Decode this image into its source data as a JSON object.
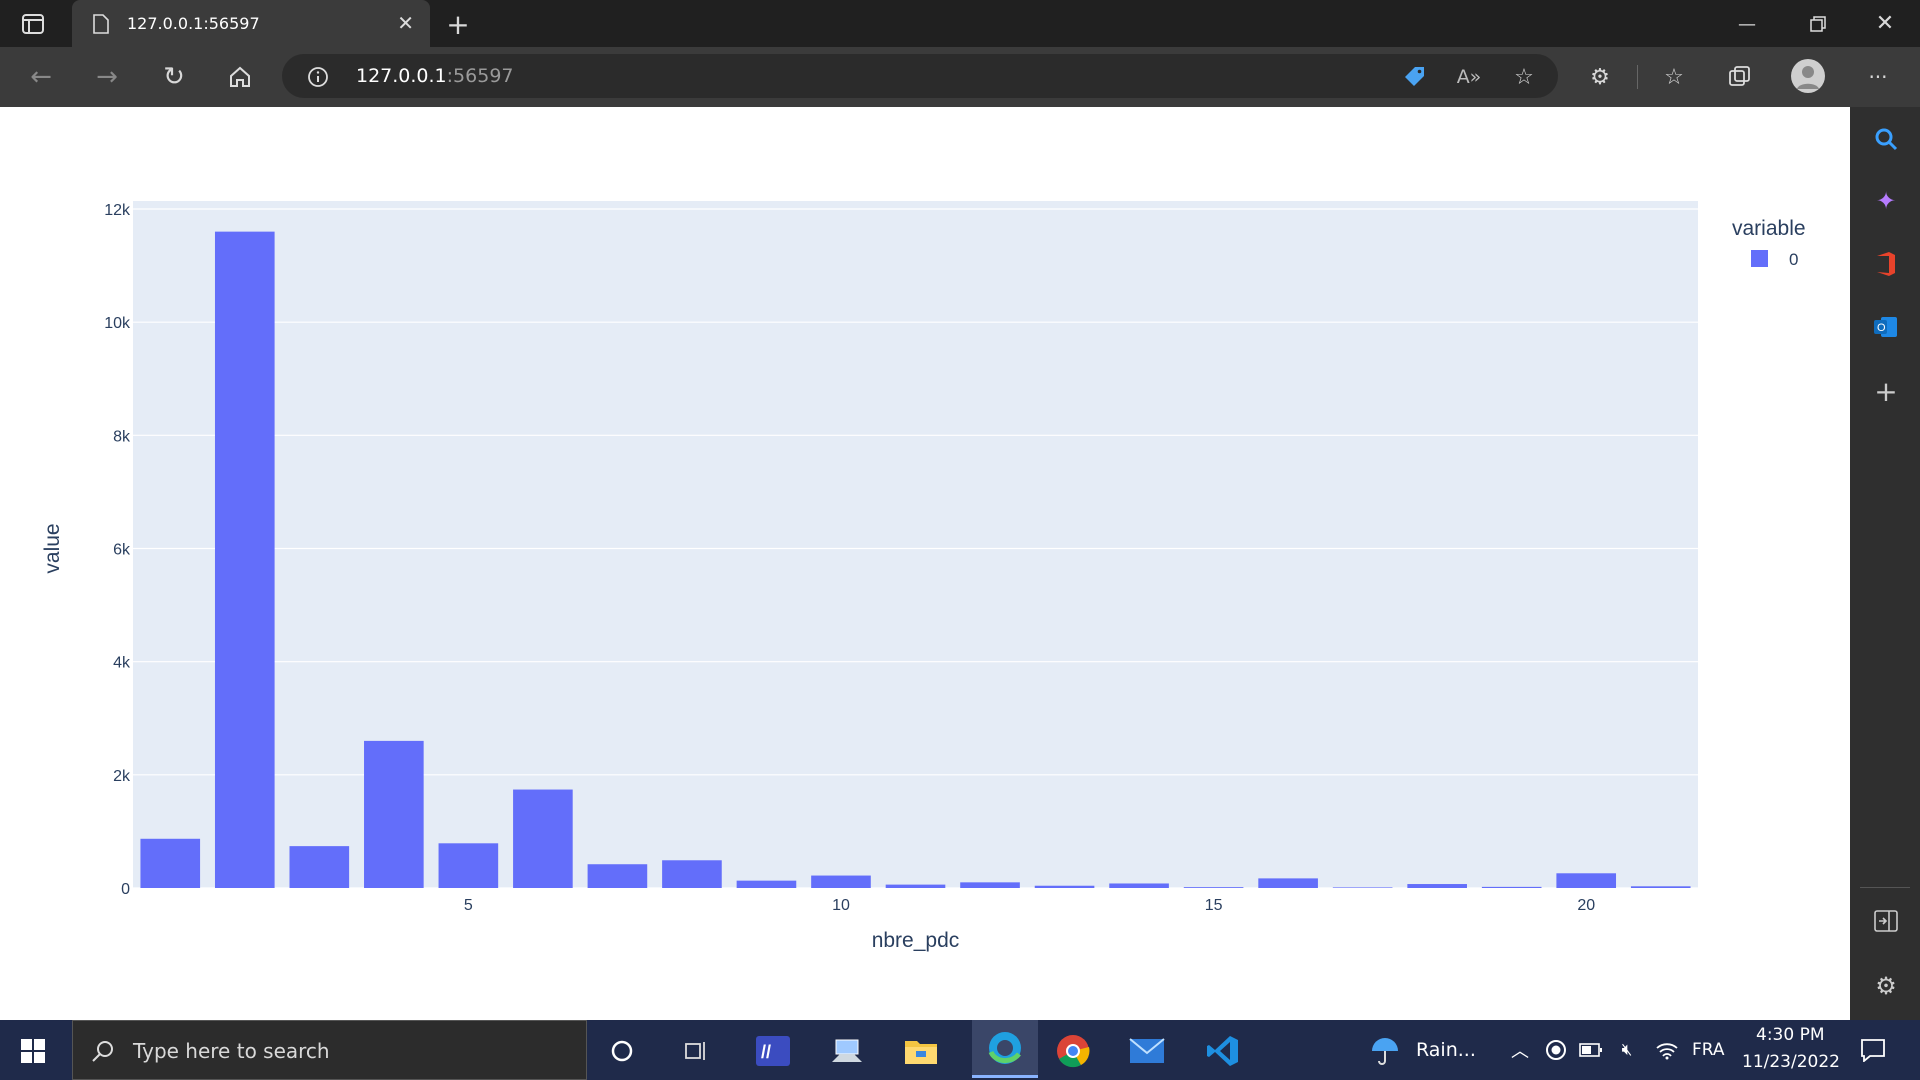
{
  "browser": {
    "tab_title": "127.0.0.1:56597",
    "url_host": "127.0.0.1",
    "url_port": ":56597"
  },
  "taskbar": {
    "search_placeholder": "Type here to search",
    "weather": "Rain...",
    "language": "FRA",
    "time": "4:30 PM",
    "date": "11/23/2022"
  },
  "chart_data": {
    "type": "bar",
    "xlabel": "nbre_pdc",
    "ylabel": "value",
    "legend_title": "variable",
    "legend_position": "top-right",
    "ylim": [
      0,
      12000
    ],
    "xlim": [
      0.5,
      21.5
    ],
    "x_ticks": [
      5,
      10,
      15,
      20
    ],
    "y_ticks": [
      0,
      2000,
      4000,
      6000,
      8000,
      10000,
      12000
    ],
    "y_tick_labels": [
      "0",
      "2k",
      "4k",
      "6k",
      "8k",
      "10k",
      "12k"
    ],
    "grid": true,
    "x": [
      1,
      2,
      3,
      4,
      5,
      6,
      7,
      8,
      9,
      10,
      11,
      12,
      13,
      14,
      15,
      16,
      17,
      18,
      19,
      20,
      21
    ],
    "series": [
      {
        "name": "0",
        "color": "#636efa",
        "values": [
          870,
          11600,
          740,
          2600,
          790,
          1740,
          420,
          490,
          130,
          220,
          60,
          100,
          40,
          80,
          15,
          170,
          10,
          70,
          20,
          260,
          30
        ]
      }
    ]
  }
}
